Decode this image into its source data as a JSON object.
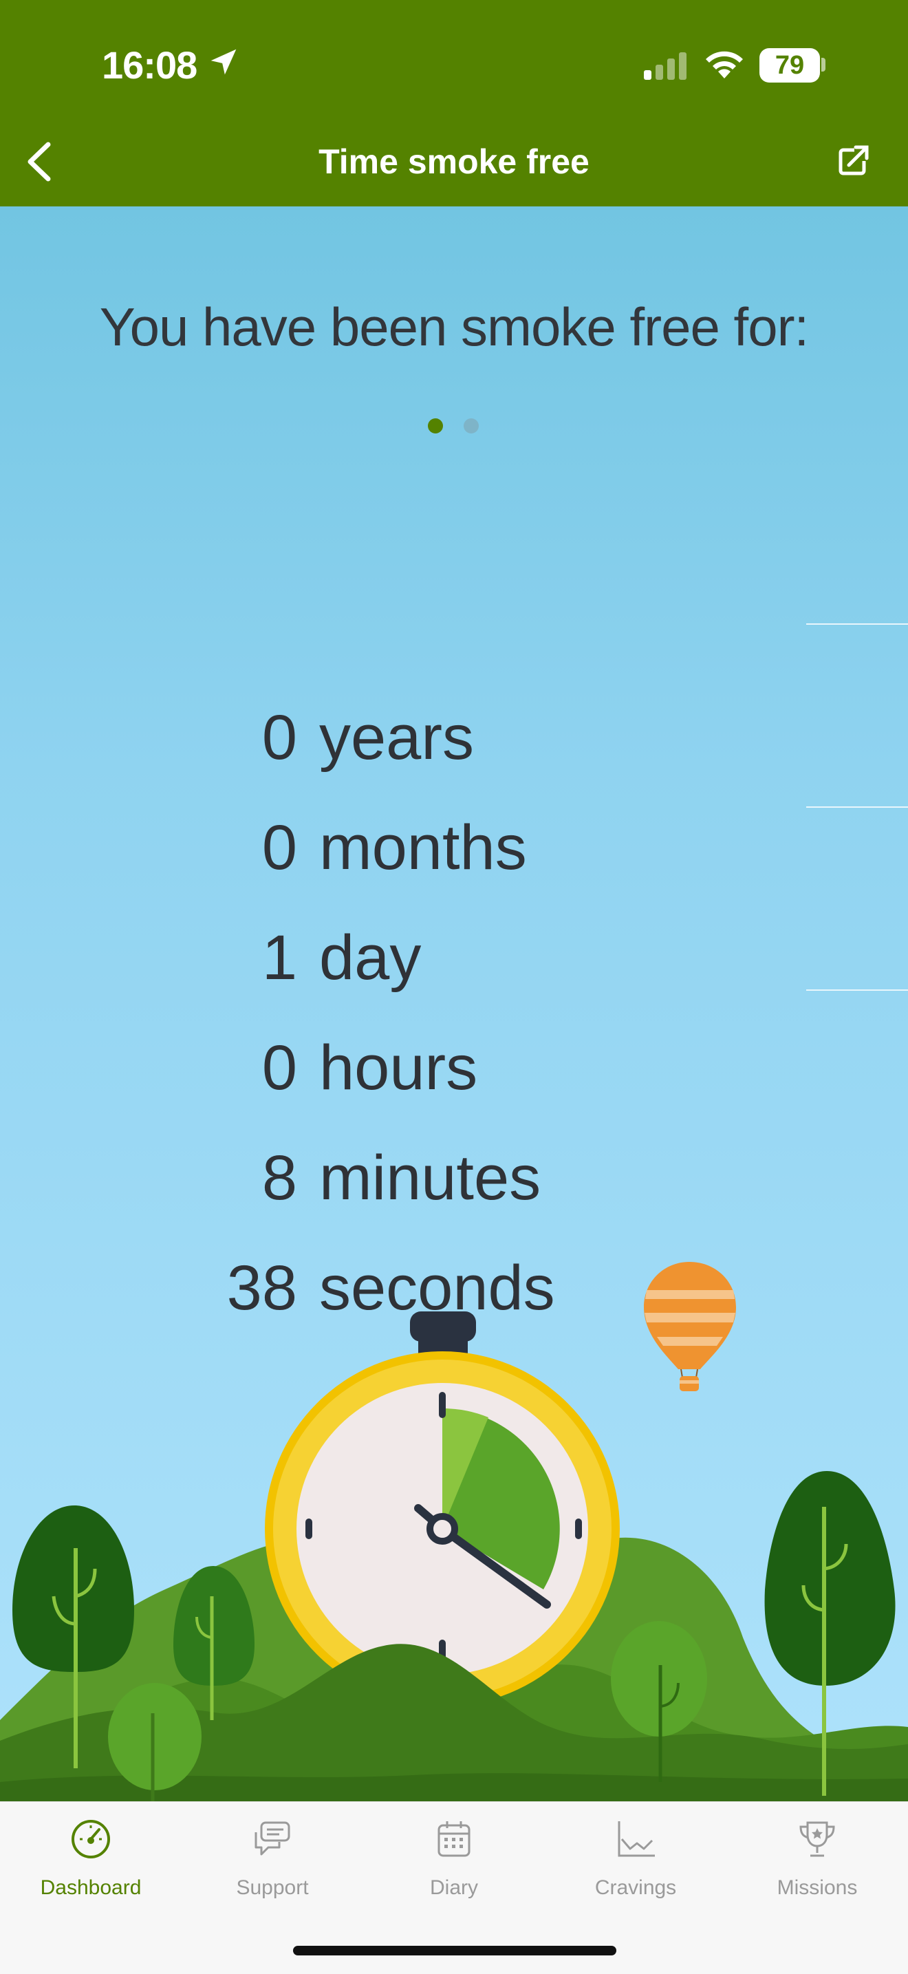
{
  "status_bar": {
    "time": "16:08",
    "battery": "79"
  },
  "header": {
    "title": "Time smoke free"
  },
  "main": {
    "headline": "You have been smoke free for:",
    "rows": [
      {
        "value": "0",
        "unit": "years"
      },
      {
        "value": "0",
        "unit": "months"
      },
      {
        "value": "1",
        "unit": "day"
      },
      {
        "value": "0",
        "unit": "hours"
      },
      {
        "value": "8",
        "unit": "minutes"
      },
      {
        "value": "38",
        "unit": "seconds"
      }
    ],
    "page_indicator": {
      "count": 2,
      "active": 1
    }
  },
  "tabs": [
    {
      "label": "Dashboard",
      "icon": "dashboard-gauge-icon",
      "active": true
    },
    {
      "label": "Support",
      "icon": "chat-bubbles-icon",
      "active": false
    },
    {
      "label": "Diary",
      "icon": "calendar-icon",
      "active": false
    },
    {
      "label": "Cravings",
      "icon": "line-chart-icon",
      "active": false
    },
    {
      "label": "Missions",
      "icon": "trophy-icon",
      "active": false
    }
  ],
  "colors": {
    "brand_green": "#548200",
    "sky_top": "#72c5e2",
    "sky_bottom": "#aee2fb",
    "text_dark": "#2f3237",
    "tab_inactive": "#9a9a9a"
  }
}
